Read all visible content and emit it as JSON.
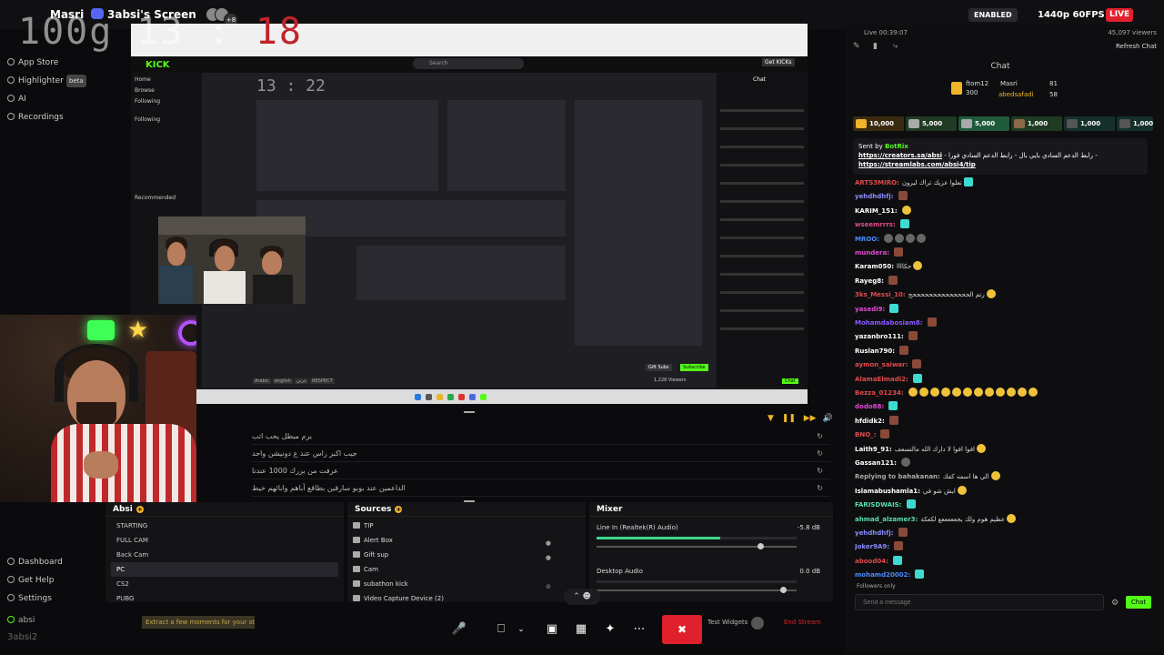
{
  "topbar": {
    "user": "Masri",
    "screen_title": "3absi's Screen",
    "avatar_count": "+8",
    "enabled": "ENABLED",
    "quality": "1440p 60FPS",
    "live": "LIVE"
  },
  "clock": {
    "main": "100g 13 : ",
    "red": "18"
  },
  "leftnav": {
    "items": [
      {
        "label": "App Store"
      },
      {
        "label": "Highlighter",
        "badge": "beta"
      },
      {
        "label": "AI"
      },
      {
        "label": "Recordings"
      }
    ],
    "bottom": [
      {
        "label": "Dashboard"
      },
      {
        "label": "Get Help"
      },
      {
        "label": "Settings"
      }
    ],
    "user": "absi",
    "watermark": "3absi2"
  },
  "preview": {
    "kick_logo": "KICK",
    "search": "Search",
    "get_kick": "Get KICKs",
    "side": [
      "Home",
      "Browse",
      "Following",
      "Following",
      "Recommended"
    ],
    "chat_header": "Chat",
    "inner_time": "13 : 22",
    "tags": [
      "Arabic",
      "english",
      "عربي",
      "RESPECT"
    ],
    "gift_subs": "Gift Subs",
    "subscribe": "Subscribe",
    "viewers": "1,228 Viewers",
    "chatbtn": "Chat"
  },
  "events": {
    "rows": [
      {
        "text": "برم مبطل يحب اتب"
      },
      {
        "text": "جيب اكبر راس عند ع دونيشن واحد"
      },
      {
        "text": "عرفت من يزرك 1000 عندنا"
      },
      {
        "text": "الداعمين عند بوبو سارقين بطاقع أباهم وابائهم خيط"
      }
    ]
  },
  "scenes": {
    "title": "Absi",
    "items": [
      {
        "label": "STARTING"
      },
      {
        "label": "FULL CAM"
      },
      {
        "label": "Back Cam"
      },
      {
        "label": "PC"
      },
      {
        "label": "CS2"
      },
      {
        "label": "PUBG"
      }
    ],
    "selected": "PC"
  },
  "sources": {
    "title": "Sources",
    "items": [
      {
        "label": "TIP"
      },
      {
        "label": "Alert Box"
      },
      {
        "label": "Gift sup"
      },
      {
        "label": "Cam"
      },
      {
        "label": "subathon kick"
      },
      {
        "label": "Video Capture Device (2)"
      }
    ]
  },
  "mixer": {
    "title": "Mixer",
    "channels": [
      {
        "name": "Line In (Realtek(R) Audio)",
        "db": "-5.8 dB",
        "level": 0.62,
        "fader": 0.82
      },
      {
        "name": "Desktop Audio",
        "db": "0.0 dB",
        "level": 0.0,
        "fader": 0.93
      }
    ]
  },
  "toolbar": {
    "alert": "Extract a few moments for your stream",
    "test_widgets": "Test Widgets",
    "end_stream": "End Stream"
  },
  "right": {
    "live_time": "Live 00:39:07",
    "viewers": "45,097 viewers",
    "refresh": "Refresh Chat",
    "chat_title": "Chat",
    "top_gifters": [
      {
        "name": "ftom12",
        "count": "300"
      },
      {
        "name": "Masri",
        "count": "81"
      },
      {
        "name": "abedsafadi",
        "count": "58"
      }
    ],
    "gifts": [
      "10,000",
      "5,000",
      "5,000",
      "1,000",
      "1,000",
      "1,000"
    ],
    "pinned": {
      "sent_by": "Sent by",
      "bot": "BotRix",
      "line1": "https://creators.sa/absi",
      "line1_ar": " - رابط الدعم السادي بايي بال - رابط الدعم السادي فورا -",
      "line2": "https://streamlabs.com/absi4/tip"
    },
    "messages": [
      {
        "user": "ARTS3MIRO:",
        "text": "تعلوا عزيك تراك ليرون",
        "color": "#e04a4a"
      },
      {
        "user": "yehdhdhfj:",
        "text": "",
        "color": "#8a8aff"
      },
      {
        "user": "KARIM_151:",
        "text": "",
        "color": "#ffffff"
      },
      {
        "user": "wseemrrrs:",
        "text": "",
        "color": "#e04a8a"
      },
      {
        "user": "MROO:",
        "text": "",
        "color": "#4a8aff"
      },
      {
        "user": "mundera:",
        "text": "",
        "color": "#e04ad0"
      },
      {
        "user": "Karam050:",
        "text": "حكاااا",
        "color": "#ffffff"
      },
      {
        "user": "Rayeg8:",
        "text": "",
        "color": "#ffffff"
      },
      {
        "user": "3ks_Messi_10:",
        "text": "رتم الححححححححححححححح",
        "color": "#e04a4a"
      },
      {
        "user": "yasedi9:",
        "text": "",
        "color": "#e04ad0"
      },
      {
        "user": "Mohamdabosiam8:",
        "text": "",
        "color": "#8a5aff"
      },
      {
        "user": "yazanbro111:",
        "text": "",
        "color": "#ffffff"
      },
      {
        "user": "Ruslan790:",
        "text": "",
        "color": "#ffffff"
      },
      {
        "user": "aymon_saiwar:",
        "text": "",
        "color": "#e04a4a"
      },
      {
        "user": "AlamaElmadi2:",
        "text": "",
        "color": "#e04a4a"
      },
      {
        "user": "Bezza_01234:",
        "text": "",
        "color": "#e04a4a"
      },
      {
        "user": "dodo88:",
        "text": "",
        "color": "#e04ad0"
      },
      {
        "user": "hfdidk2:",
        "text": "",
        "color": "#ffffff"
      },
      {
        "user": "BNO_:",
        "text": "",
        "color": "#e04a4a"
      },
      {
        "user": "Laith9_91:",
        "text": "افوا افوا لا دارك الله مالتسعف",
        "color": "#ffffff"
      },
      {
        "user": "Gassan121:",
        "text": "",
        "color": "#ffffff"
      },
      {
        "user": "Replying to bahakanan:",
        "text": "الي ها اسمه كفك",
        "color": "#aaaaaa"
      },
      {
        "user": "Islamabushamla1:",
        "text": "ايش شو في",
        "color": "#ffffff"
      },
      {
        "user": "FARISDWAIS:",
        "text": "",
        "color": "#5adfae"
      },
      {
        "user": "ahmad_alzamer3:",
        "text": "عظيم هوم ولك يجعععععع لكعكة",
        "color": "#5adfae"
      },
      {
        "user": "yehdhdhfj:",
        "text": "",
        "color": "#8a8aff"
      },
      {
        "user": "Joker9A9:",
        "text": "",
        "color": "#8a8aff"
      },
      {
        "user": "abood04:",
        "text": "",
        "color": "#e04a4a"
      },
      {
        "user": "mohamd20002:",
        "text": "",
        "color": "#4a8aff"
      }
    ],
    "followers_only": "Followers only",
    "send_placeholder": "Send a message",
    "chat_button": "Chat"
  }
}
